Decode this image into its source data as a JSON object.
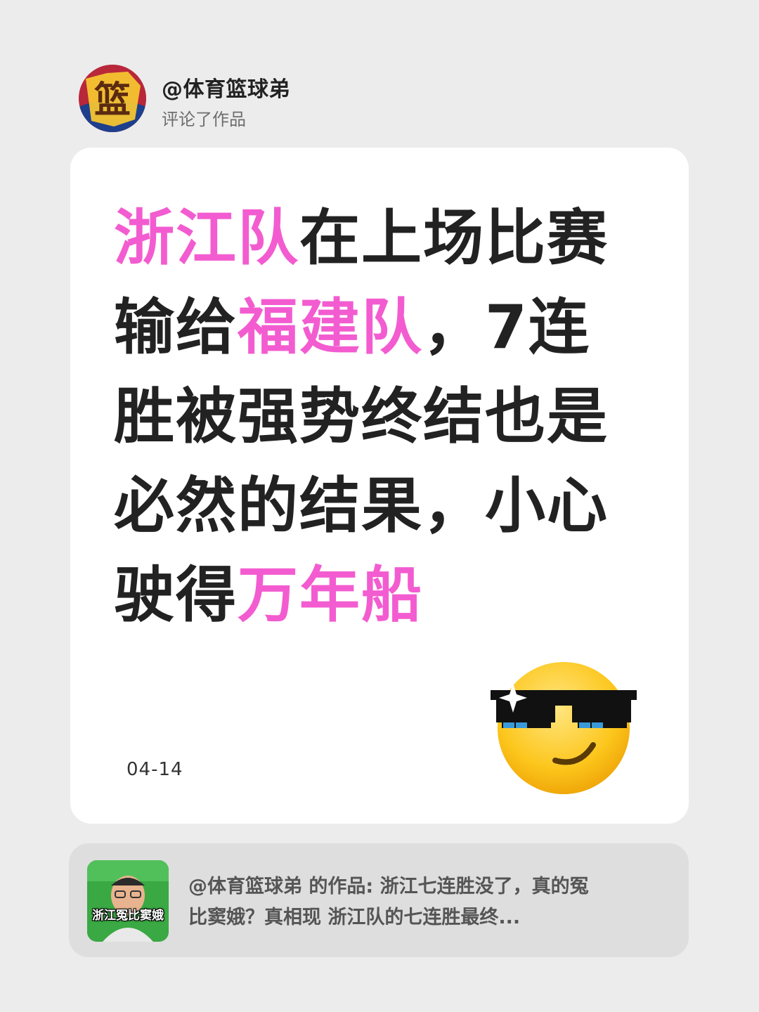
{
  "header": {
    "user_name": "@体育篮球弟",
    "action": "评论了作品",
    "avatar_text": "篮"
  },
  "comment": {
    "lines": [
      [
        {
          "text": "浙江队",
          "highlight": true
        },
        {
          "text": "在上场比赛",
          "highlight": false
        }
      ],
      [
        {
          "text": "输给",
          "highlight": false
        },
        {
          "text": "福建队",
          "highlight": true
        },
        {
          "text": "，7连",
          "highlight": false
        }
      ],
      [
        {
          "text": "胜被强势终结也是",
          "highlight": false
        }
      ],
      [
        {
          "text": "必然的结果，小心",
          "highlight": false
        }
      ],
      [
        {
          "text": "驶得",
          "highlight": false
        },
        {
          "text": "万年船",
          "highlight": true
        }
      ]
    ],
    "date": "04-14",
    "emoji": "sunglasses-smiling-face"
  },
  "source": {
    "thumbnail_caption": "浙江冤比窦娥",
    "line1": "@体育篮球弟 的作品: 浙江七连胜没了，真的冤",
    "line2": "比窦娥？真相现 浙江队的七连胜最终..."
  },
  "colors": {
    "background": "#ececec",
    "highlight": "#f35cd0",
    "text": "#222222",
    "secondary_text": "#6e6e6e"
  }
}
